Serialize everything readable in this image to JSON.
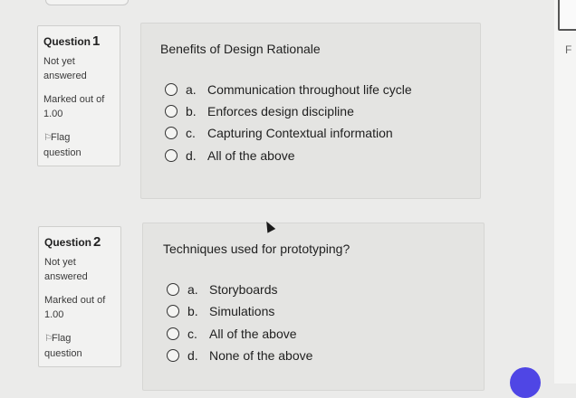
{
  "questions": [
    {
      "label": "Question",
      "number": "1",
      "status": "Not yet answered",
      "marked": "Marked out of 1.00",
      "flag": "Flag question",
      "text": "Benefits of Design Rationale",
      "answers": [
        {
          "letter": "a.",
          "text": "Communication throughout life cycle"
        },
        {
          "letter": "b.",
          "text": "Enforces design discipline"
        },
        {
          "letter": "c.",
          "text": "Capturing Contextual information"
        },
        {
          "letter": "d.",
          "text": "All of the above"
        }
      ]
    },
    {
      "label": "Question",
      "number": "2",
      "status": "Not yet answered",
      "marked": "Marked out of 1.00",
      "flag": "Flag question",
      "text": "Techniques used for prototyping?",
      "answers": [
        {
          "letter": "a.",
          "text": "Storyboards"
        },
        {
          "letter": "b.",
          "text": "Simulations"
        },
        {
          "letter": "c.",
          "text": "All of the above"
        },
        {
          "letter": "d.",
          "text": "None of the above"
        }
      ]
    }
  ],
  "edge": {
    "letter": "F"
  },
  "icons": {
    "flag": "flag-icon",
    "fab": "chat-icon"
  },
  "colors": {
    "fab": "#4f46e5"
  }
}
